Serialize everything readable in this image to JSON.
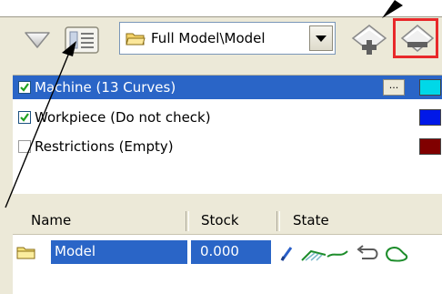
{
  "toolbar": {
    "folder_path": "Full Model\\Model",
    "icons": {
      "collapse": "collapse-triangle-icon",
      "view": "detail-view-icon",
      "folder": "folder-open-icon",
      "dropdown": "chevron-down-icon",
      "add": "add-layer-icon",
      "remove": "remove-layer-icon"
    }
  },
  "layers": [
    {
      "label": "Machine  (13 Curves)",
      "checked": true,
      "selected": true,
      "color": "#00d8e8",
      "has_ellipsis": true,
      "ellipsis_label": "..."
    },
    {
      "label": "Workpiece  (Do not check)",
      "checked": true,
      "selected": false,
      "color": "#0018e8"
    },
    {
      "label": "Restrictions  (Empty)",
      "checked": false,
      "selected": false,
      "color": "#800000"
    }
  ],
  "model_table": {
    "columns": [
      "Name",
      "Stock",
      "State"
    ],
    "rows": [
      {
        "name": "Model",
        "stock": "0.000",
        "state_icons": [
          "pencil-icon",
          "surface-icon",
          "curve-icon",
          "undo-arrow-icon",
          "outline-icon"
        ]
      }
    ]
  },
  "colors": {
    "panel_bg": "#ece9d8",
    "selection": "#2a65c7",
    "highlight_frame": "#e8282a"
  }
}
